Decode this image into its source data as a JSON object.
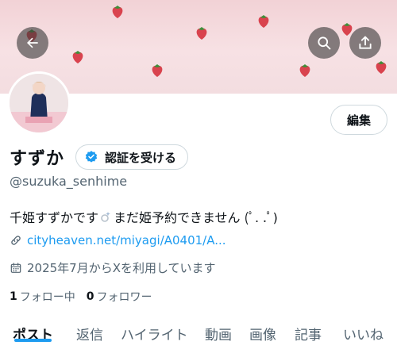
{
  "profile": {
    "display_name": "すずか",
    "handle": "@suzuka_senhime",
    "bio_before": "千姫すずかです",
    "bio_after": " まだ姫予約できません (ﾟ. .ﾟ)",
    "link": "cityheaven.net/miyagi/A0401/A...",
    "joined": "2025年7月からXを利用しています",
    "following_count": "1",
    "following_label": "フォロー中",
    "followers_count": "0",
    "followers_label": "フォロワー"
  },
  "buttons": {
    "edit": "編集",
    "verify": "認証を受ける"
  },
  "tabs": [
    "ポスト",
    "返信",
    "ハイライト",
    "動画",
    "画像",
    "記事",
    "いいね"
  ],
  "icons": {
    "back": "arrow-left-icon",
    "search": "search-icon",
    "share": "share-icon",
    "verify": "verified-badge-icon",
    "link": "link-icon",
    "calendar": "calendar-icon"
  },
  "colors": {
    "accent": "#1d9bf0",
    "banner": "#f2d2d6",
    "strawberry": "#d9434e"
  }
}
